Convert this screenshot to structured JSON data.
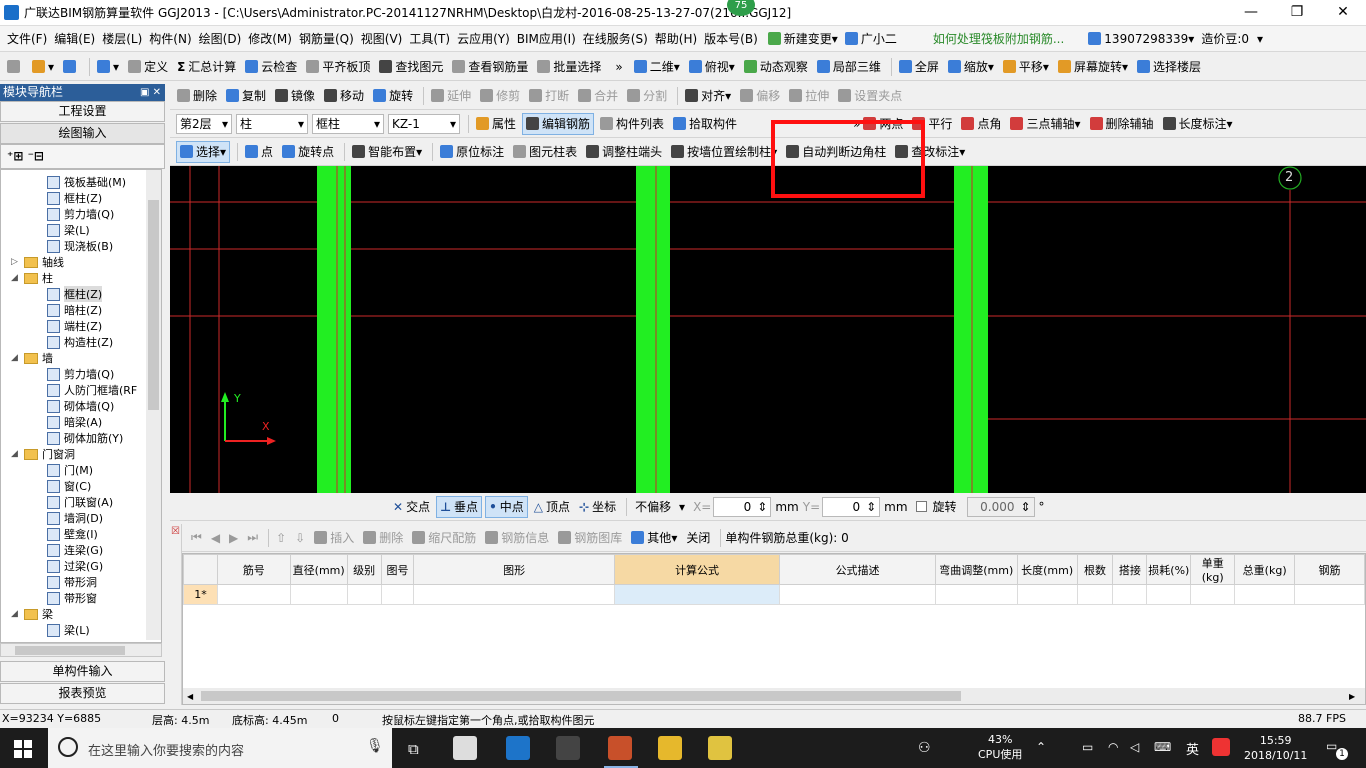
{
  "window": {
    "title": "广联达BIM钢筋算量软件 GGJ2013 - [C:\\Users\\Administrator.PC-20141127NRHM\\Desktop\\白龙村-2016-08-25-13-27-07(216...GGJ12]",
    "badge": "75",
    "min": "—",
    "max": "❐",
    "close": "✕"
  },
  "menubar": {
    "items": [
      "文件(F)",
      "编辑(E)",
      "楼层(L)",
      "构件(N)",
      "绘图(D)",
      "修改(M)",
      "钢筋量(Q)",
      "视图(V)",
      "工具(T)",
      "云应用(Y)",
      "BIM应用(I)",
      "在线服务(S)",
      "帮助(H)",
      "版本号(B)"
    ],
    "new_change": "新建变更",
    "assistant": "广小二",
    "tip": "如何处理筏板附加钢筋...",
    "phone": "13907298339",
    "beans": "造价豆:0"
  },
  "toolbar1": {
    "define": "定义",
    "sum": "汇总计算",
    "cloud_check": "云检查",
    "flush_top": "平齐板顶",
    "find": "查找图元",
    "view_rebar": "查看钢筋量",
    "batch_select": "批量选择",
    "view2d": "二维",
    "view_top": "俯视",
    "dynamic": "动态观察",
    "local3d": "局部三维",
    "full": "全屏",
    "zoom": "缩放",
    "pan": "平移",
    "rotate": "屏幕旋转",
    "select_floor": "选择楼层"
  },
  "toolbar2": {
    "delete": "删除",
    "copy": "复制",
    "mirror": "镜像",
    "move": "移动",
    "rotate": "旋转",
    "extend": "延伸",
    "trim": "修剪",
    "break": "打断",
    "merge": "合并",
    "split": "分割",
    "align": "对齐",
    "offset": "偏移",
    "stretch": "拉伸",
    "set_pinch": "设置夹点"
  },
  "toolbar3": {
    "floor": "第2层",
    "type": "柱",
    "sub": "框柱",
    "comp": "KZ-1",
    "props": "属性",
    "edit_rebar": "编辑钢筋",
    "comp_list": "构件列表",
    "pick": "拾取构件",
    "two_points": "两点",
    "parallel": "平行",
    "point_angle": "点角",
    "three_point_aux": "三点辅轴",
    "del_aux": "删除辅轴",
    "length_mark": "长度标注"
  },
  "toolbar4": {
    "select": "选择",
    "point": "点",
    "rotate_point": "旋转点",
    "smart": "智能布置",
    "orig_mark": "原位标注",
    "col_table": "图元柱表",
    "adjust_end": "调整柱端头",
    "wall_draw": "按墙位置绘制柱",
    "auto_corner": "自动判断边角柱",
    "change_mark": "查改标注"
  },
  "nav": {
    "title": "模块导航栏",
    "pin": "▣ ✕",
    "project_settings": "工程设置",
    "drawing_input": "绘图输入",
    "tree": [
      {
        "label": "筏板基础(M)",
        "level": 2,
        "kind": "item"
      },
      {
        "label": "框柱(Z)",
        "level": 2,
        "kind": "item"
      },
      {
        "label": "剪力墙(Q)",
        "level": 2,
        "kind": "item"
      },
      {
        "label": "梁(L)",
        "level": 2,
        "kind": "item"
      },
      {
        "label": "现浇板(B)",
        "level": 2,
        "kind": "item"
      },
      {
        "label": "轴线",
        "level": 1,
        "kind": "folder",
        "exp": "▷"
      },
      {
        "label": "柱",
        "level": 1,
        "kind": "folder",
        "exp": "◢"
      },
      {
        "label": "框柱(Z)",
        "level": 2,
        "kind": "item",
        "selected": true
      },
      {
        "label": "暗柱(Z)",
        "level": 2,
        "kind": "item"
      },
      {
        "label": "端柱(Z)",
        "level": 2,
        "kind": "item"
      },
      {
        "label": "构造柱(Z)",
        "level": 2,
        "kind": "item"
      },
      {
        "label": "墙",
        "level": 1,
        "kind": "folder",
        "exp": "◢"
      },
      {
        "label": "剪力墙(Q)",
        "level": 2,
        "kind": "item"
      },
      {
        "label": "人防门框墙(RF",
        "level": 2,
        "kind": "item"
      },
      {
        "label": "砌体墙(Q)",
        "level": 2,
        "kind": "item"
      },
      {
        "label": "暗梁(A)",
        "level": 2,
        "kind": "item"
      },
      {
        "label": "砌体加筋(Y)",
        "level": 2,
        "kind": "item"
      },
      {
        "label": "门窗洞",
        "level": 1,
        "kind": "folder",
        "exp": "◢"
      },
      {
        "label": "门(M)",
        "level": 2,
        "kind": "item"
      },
      {
        "label": "窗(C)",
        "level": 2,
        "kind": "item"
      },
      {
        "label": "门联窗(A)",
        "level": 2,
        "kind": "item"
      },
      {
        "label": "墙洞(D)",
        "level": 2,
        "kind": "item"
      },
      {
        "label": "壁龛(I)",
        "level": 2,
        "kind": "item"
      },
      {
        "label": "连梁(G)",
        "level": 2,
        "kind": "item"
      },
      {
        "label": "过梁(G)",
        "level": 2,
        "kind": "item"
      },
      {
        "label": "带形洞",
        "level": 2,
        "kind": "item"
      },
      {
        "label": "带形窗",
        "level": 2,
        "kind": "item"
      },
      {
        "label": "梁",
        "level": 1,
        "kind": "folder",
        "exp": "◢"
      },
      {
        "label": "梁(L)",
        "level": 2,
        "kind": "item"
      }
    ],
    "single_input": "单构件输入",
    "report": "报表预览"
  },
  "canvas": {
    "axis_y": "Y",
    "axis_x": "X",
    "axis_num": "2"
  },
  "snapbar": {
    "intersect": "交点",
    "perp": "垂点",
    "mid": "中点",
    "vertex": "顶点",
    "coord": "坐标",
    "no_offset": "不偏移",
    "x_label": "X=",
    "x_val": "0",
    "mm1": "mm",
    "y_label": "Y=",
    "y_val": "0",
    "mm2": "mm",
    "rotate": "旋转",
    "rotate_val": "0.000",
    "deg": "°"
  },
  "gridbar": {
    "insert": "插入",
    "delete": "删除",
    "scale": "缩尺配筋",
    "info": "钢筋信息",
    "lib": "钢筋图库",
    "other": "其他",
    "close": "关闭",
    "total": "单构件钢筋总重(kg): 0"
  },
  "grid": {
    "headers": [
      "",
      "筋号",
      "直径(mm)",
      "级别",
      "图号",
      "图形",
      "计算公式",
      "公式描述",
      "弯曲调整(mm)",
      "长度(mm)",
      "根数",
      "搭接",
      "损耗(%)",
      "单重(kg)",
      "总重(kg)",
      "钢筋"
    ],
    "row1": "1*"
  },
  "status": {
    "coord": "X=93234 Y=6885",
    "floor_h": "层高: 4.5m",
    "base_h": "底标高: 4.45m",
    "zero": "0",
    "hint": "按鼠标左键指定第一个角点,或拾取构件图元",
    "fps": "88.7 FPS"
  },
  "taskbar": {
    "search": "在这里输入你要搜索的内容",
    "cpu": "43%",
    "cpu_label": "CPU使用",
    "ime": "英",
    "time": "15:59",
    "date": "2018/10/11",
    "notif": "1"
  },
  "colors": {
    "canvas": "#000000",
    "column": "#22ee22",
    "gridline": "#cc2a2a",
    "highlight": "#ff1010",
    "accent": "#2c5e99"
  }
}
